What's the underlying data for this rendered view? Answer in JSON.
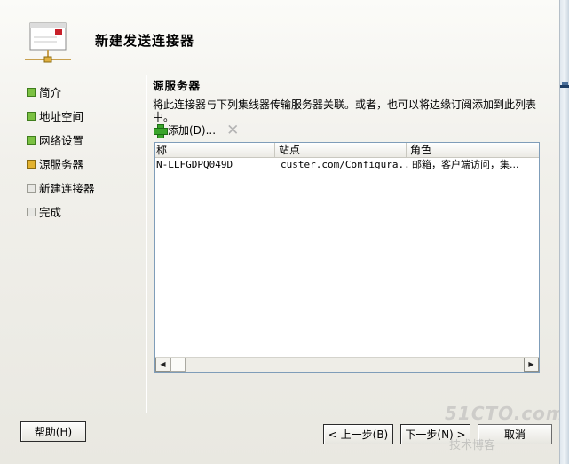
{
  "wizard": {
    "title": "新建发送连接器",
    "steps": [
      {
        "label": "简介",
        "state": "done"
      },
      {
        "label": "地址空间",
        "state": "done"
      },
      {
        "label": "网络设置",
        "state": "done"
      },
      {
        "label": "源服务器",
        "state": "current"
      },
      {
        "label": "新建连接器",
        "state": "pending"
      },
      {
        "label": "完成",
        "state": "pending"
      }
    ],
    "step_colors": {
      "done": "#7bc142",
      "current": "#e3b22e",
      "pending": "#e8e8e4"
    }
  },
  "content": {
    "heading": "源服务器",
    "description": "将此连接器与下列集线器传输服务器关联。或者，也可以将边缘订阅添加到此列表中。",
    "toolbar": {
      "add_label": "添加(D)...",
      "add_icon": "plus-icon",
      "remove_icon": "x-icon"
    },
    "list": {
      "columns": [
        "称",
        "站点",
        "角色"
      ],
      "rows": [
        {
          "name": "N-LLFGDPQ049D",
          "site": "custer.com/Configura...",
          "role": "邮箱，客户端访问，集..."
        }
      ]
    }
  },
  "buttons": {
    "help": "帮助(H)",
    "back": "< 上一步(B)",
    "next": "下一步(N) >",
    "cancel": "取消"
  },
  "watermark": {
    "site": "51CTO.com",
    "blog": "技术博客"
  }
}
